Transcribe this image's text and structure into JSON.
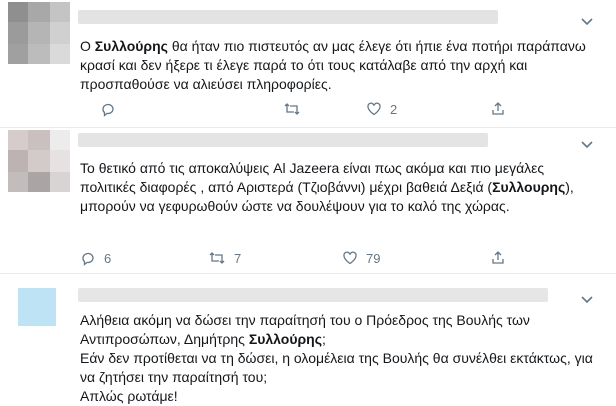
{
  "tweets": [
    {
      "id": "t1",
      "segments": [
        {
          "text": "Ο ",
          "bold": false
        },
        {
          "text": "Συλλούρης",
          "bold": true
        },
        {
          "text": " θα ήταν πιο πιστευτός αν μας έλεγε ότι ήπιε ένα ποτήρι παράπανω κρασί και δεν ήξερε τι έλεγε παρά το ότι τους κατάλαβε από την αρχή και προσπαθούσε να αλιεύσει πληροφορίες.",
          "bold": false
        }
      ],
      "actions": {
        "reply": "",
        "retweet": "",
        "like": "2"
      }
    },
    {
      "id": "t2",
      "segments": [
        {
          "text": "Το θετικό από τις αποκαλύψεις Al Jazeera είναι πως ακόμα και πιο μεγάλες πολιτικές διαφορές , από Αριστερά (Τζιοβάννι) μέχρι βαθειά Δεξιά (",
          "bold": false
        },
        {
          "text": "Συλλουρης",
          "bold": true
        },
        {
          "text": "), μπορούν να γεφυρωθούν ώστε να δουλέψουν για το καλό της χώρας.",
          "bold": false
        }
      ],
      "actions": {
        "reply": "6",
        "retweet": "7",
        "like": "79"
      }
    },
    {
      "id": "t3",
      "lines": [
        [
          {
            "text": "Αλήθεια ακόμη να δώσει την παραίτησή του ο Πρόεδρος της Βουλής των Αντιπροσώπων, Δημήτρης ",
            "bold": false
          },
          {
            "text": "Συλλούρης",
            "bold": true
          },
          {
            "text": ";",
            "bold": false
          }
        ],
        [
          {
            "text": "Εάν δεν προτίθεται να τη δώσει, η ολομέλεια της Βουλής θα συνέλθει εκτάκτως, για να ζητήσει την παραίτησή του;",
            "bold": false
          }
        ],
        [
          {
            "text": "Απλώς ρωτάμε!",
            "bold": false
          }
        ]
      ]
    }
  ],
  "colors": {
    "icon": "#657786",
    "text": "#14171a",
    "divider": "#e6ecf0"
  }
}
